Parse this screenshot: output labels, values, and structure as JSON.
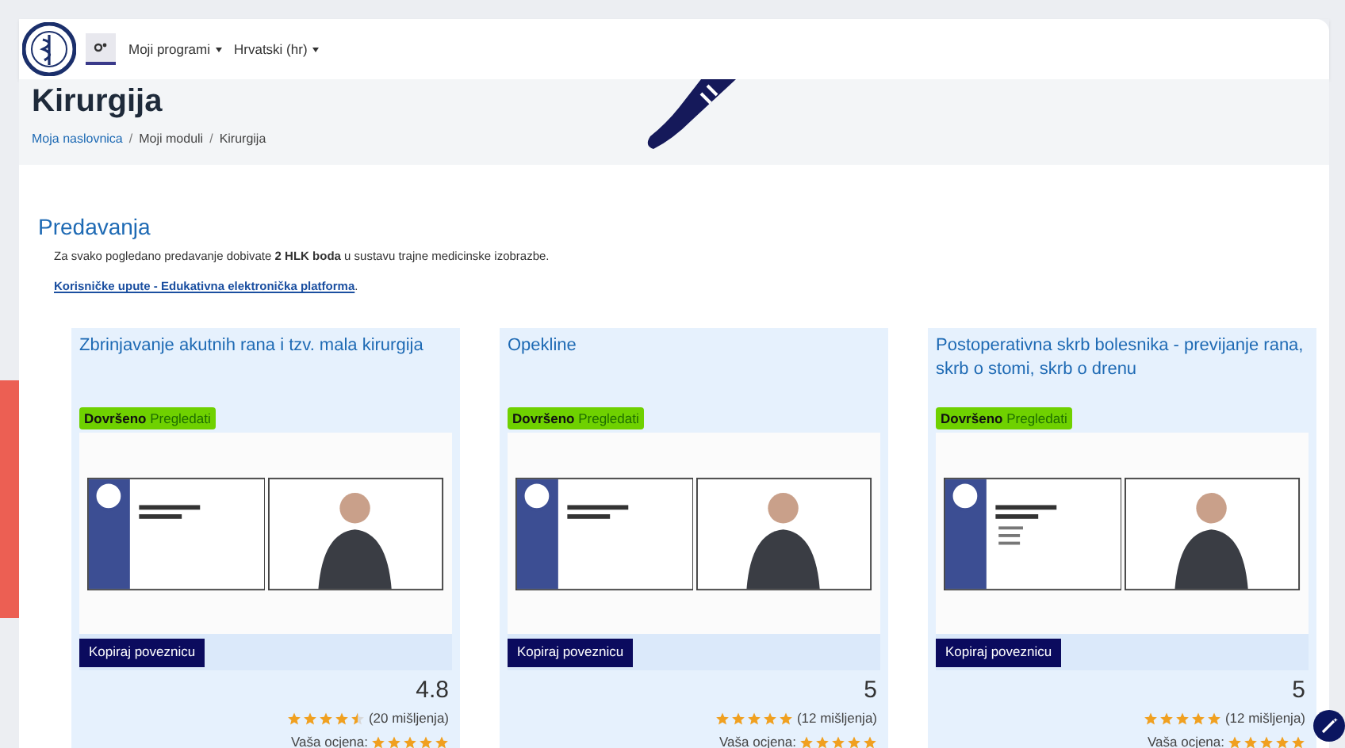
{
  "navbar": {
    "menus": [
      {
        "label": "Moji programi"
      },
      {
        "label": "Hrvatski (hr)"
      }
    ]
  },
  "header": {
    "title": "Kirurgija",
    "breadcrumb": [
      "Moja naslovnica",
      "Moji moduli",
      "Kirurgija"
    ],
    "separator": "/"
  },
  "section": {
    "title": "Predavanja",
    "intro": "Za svako pogledano predavanje dobivate **2 HLK boda** u sustavu trajne medicinske izobrazbe.",
    "link": "Korisničke upute - Edukativna elektronička platforma",
    "link_suffix": "."
  },
  "lectures": [
    {
      "title": "Zbrinjavanje akutnih rana i tzv. mala kirurgija",
      "status": "Dovršeno",
      "action": "Pregledati",
      "completed": true,
      "copy_button": "Kopiraj poveznicu",
      "rating": "4.8",
      "stars": 4.5,
      "reviews": "(20 mišljenja)",
      "your_rating": {
        "label": "Vaša ocjena:",
        "stars": 5
      },
      "slide_bullets": false
    },
    {
      "title": "Opekline",
      "status": "Dovršeno",
      "action": "Pregledati",
      "completed": true,
      "copy_button": "Kopiraj poveznicu",
      "rating": "5",
      "stars": 5,
      "reviews": "(12 mišljenja)",
      "your_rating": {
        "label": "Vaša ocjena:",
        "stars": 5
      },
      "slide_bullets": false
    },
    {
      "title": "Postoperativna skrb bolesnika - previjanje rana, skrb o stomi, skrb o drenu",
      "status": "Dovršeno",
      "action": "Pregledati",
      "completed": true,
      "copy_button": "Kopiraj poveznicu",
      "rating": "5",
      "stars": 5,
      "reviews": "(12 mišljenja)",
      "your_rating": {
        "label": "Vaša ocjena:",
        "stars": 5
      },
      "slide_bullets": true
    }
  ]
}
